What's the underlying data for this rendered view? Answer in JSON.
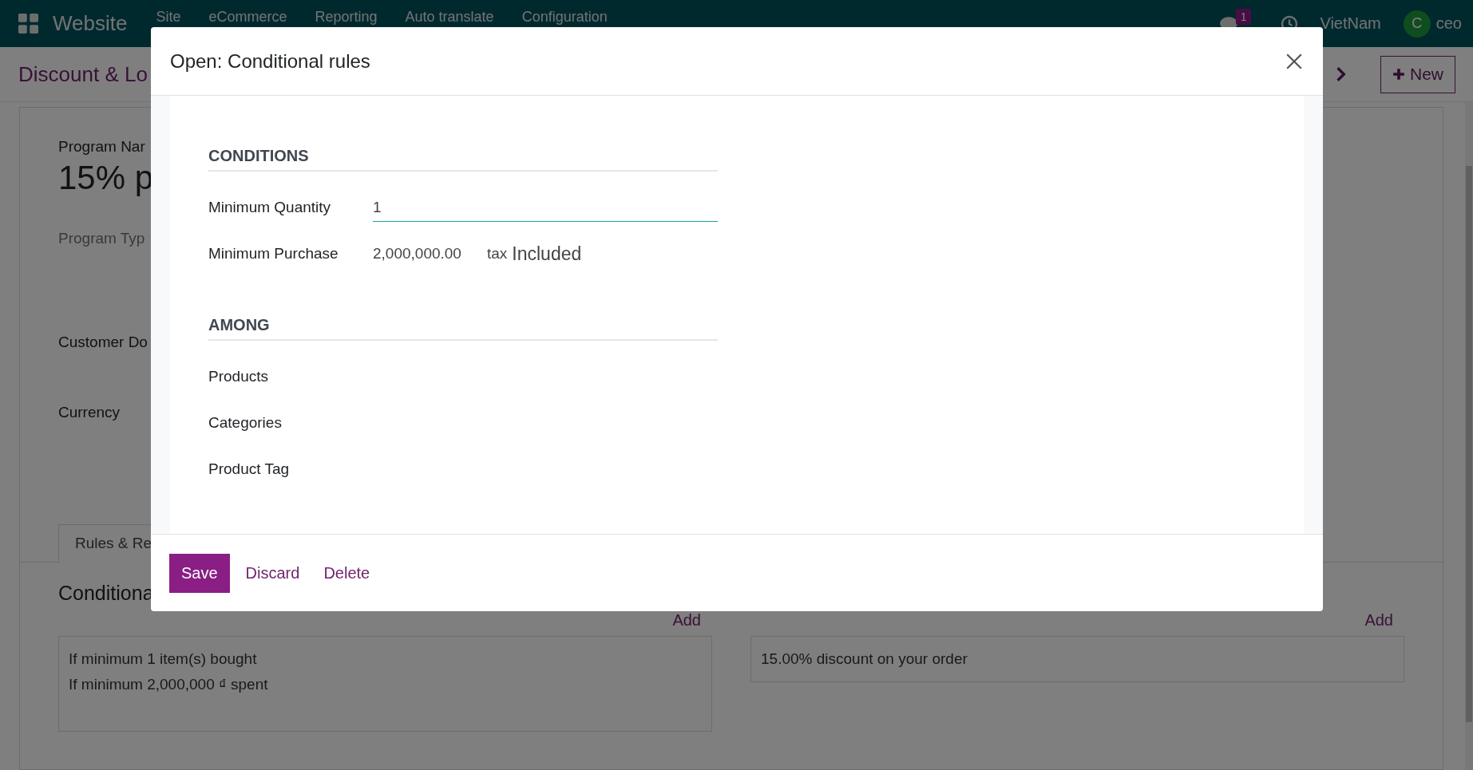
{
  "navbar": {
    "app": "Website",
    "menu": [
      "Site",
      "eCommerce",
      "Reporting",
      "Auto translate",
      "Configuration"
    ],
    "message_count": "1",
    "company": "VietNam",
    "user_initial": "C",
    "user": "ceo"
  },
  "control_panel": {
    "breadcrumb": "Discount & Lo",
    "new_button": "New"
  },
  "form": {
    "name_label": "Program Nar",
    "name_value": "15% p",
    "type_label": "Program Typ",
    "fields": [
      "Customer Do",
      "Currency"
    ],
    "tabs": [
      {
        "label": "Rules & Re",
        "selected": true
      }
    ],
    "conditions_title": "Conditiona",
    "add_links": [
      "Add",
      "Add"
    ],
    "condition_lines": [
      "If minimum 1 item(s) bought",
      "If minimum 2,000,000 ₫ spent"
    ],
    "reward_lines": [
      "15.00% discount on your order"
    ]
  },
  "dialog": {
    "title": "Open: Conditional rules",
    "sections": [
      {
        "title": "CONDITIONS",
        "fields": [
          {
            "label": "Minimum Quantity",
            "kind": "input",
            "value": "1"
          },
          {
            "label": "Minimum Purchase",
            "kind": "amount",
            "value": "2,000,000.00",
            "tax_label": "tax",
            "tax_mode": "Included"
          }
        ]
      },
      {
        "title": "AMONG",
        "fields": [
          {
            "label": "Products",
            "kind": "empty"
          },
          {
            "label": "Categories",
            "kind": "empty"
          },
          {
            "label": "Product Tag",
            "kind": "empty"
          }
        ]
      }
    ],
    "buttons": [
      {
        "label": "Save",
        "kind": "primary"
      },
      {
        "label": "Discard",
        "kind": "link"
      },
      {
        "label": "Delete",
        "kind": "link"
      }
    ]
  }
}
